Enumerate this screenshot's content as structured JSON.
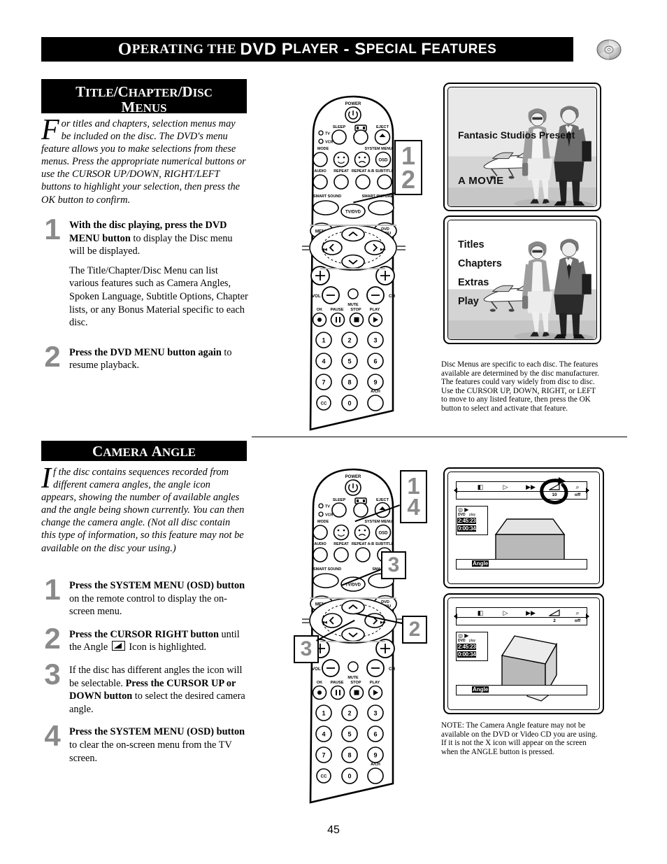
{
  "header": {
    "title_parts": [
      "O",
      "PERATING THE ",
      "DVD",
      "P",
      "LAYER",
      " - ",
      "S",
      "PECIAL ",
      "F",
      "EATURES"
    ],
    "title_full": "OPERATING THE DVD PLAYER - SPECIAL FEATURES",
    "disc_icon": "dvd-disc-icon"
  },
  "section1": {
    "bar_line1": "TITLE/CHAPTER/DISC",
    "bar_line2": "MENUS",
    "intro_dropcap": "F",
    "intro_text": "or titles and chapters, selection menus may be included on the disc. The DVD's menu feature allows you to make selections from these menus. Press the appropriate numerical buttons or use the CURSOR UP/DOWN, RIGHT/LEFT buttons to highlight your selection, then press the OK button to confirm.",
    "steps": [
      {
        "num": "1",
        "bold": "With the disc playing, press the DVD MENU button",
        "rest": " to display the Disc menu will be displayed.",
        "sub": "The Title/Chapter/Disc Menu can list various features such as Camera Angles, Spoken Language, Subtitle Options, Chapter lists, or any Bonus Material specific to each disc."
      },
      {
        "num": "2",
        "bold": "Press the DVD MENU button again",
        "rest": " to resume playback.",
        "sub": ""
      }
    ],
    "caption": "Disc Menus are specific to each disc. The features available are determined by the disc manufacturer. The features could vary widely from disc to disc. Use the CURSOR UP, DOWN, RIGHT, or LEFT to move to any listed feature, then press the OK button to select and activate that feature.",
    "callouts": [
      "1",
      "2"
    ],
    "tv1": {
      "line1": "Fantasic Studios Present",
      "line2": "A MOVIE"
    },
    "tv2": {
      "items": [
        "Titles",
        "Chapters",
        "Extras",
        "Play"
      ]
    }
  },
  "section2": {
    "bar_line1": "CAMERA ANGLE",
    "intro_dropcap": "I",
    "intro_text": "f the disc contains sequences recorded from different camera angles, the angle icon appears, showing the number of available angles and the angle being shown currently. You can then change the camera angle. (Not all disc contain this type of information, so this feature may not be available on the disc your using.)",
    "steps": [
      {
        "num": "1",
        "bold": "Press the SYSTEM MENU (OSD) button",
        "rest": " on the remote control to display the on-screen menu.",
        "sub": ""
      },
      {
        "num": "2",
        "bold": "Press the CURSOR RIGHT button",
        "rest": " until the Angle ▱ Icon is highlighted.",
        "rest_pre": " until the Angle ",
        "rest_post": " Icon is highlighted.",
        "sub": ""
      },
      {
        "num": "3",
        "bold": "",
        "pre": "If the disc has different angles the icon will be selectable. ",
        "boldmid": "Press the CURSOR UP or DOWN button",
        "rest": " to select the desired camera angle.",
        "sub": ""
      },
      {
        "num": "4",
        "bold": "Press the SYSTEM MENU (OSD) button",
        "rest": " to clear the on-screen menu from the TV screen.",
        "sub": ""
      }
    ],
    "caption": "NOTE: The Camera Angle feature may not be available on the DVD or Video CD you are using. If it is not the X icon will appear on the screen when the ANGLE button is pressed.",
    "callouts": [
      "1",
      "4",
      "3",
      "2",
      "3"
    ],
    "osd1": {
      "icons": [
        "subtitle-icon",
        "audio-icon",
        "fast-forward-icon",
        "angle-icon",
        "zoom-icon"
      ],
      "angle_value": "10",
      "zoom_value": "off",
      "disc_type": "DVD",
      "play_label": "play",
      "total_time": "2:45:23",
      "elapsed_time": "0:00:34",
      "label": "Angle",
      "rotate_arrow": "circular-arrow-icon"
    },
    "osd2": {
      "icons": [
        "subtitle-icon",
        "audio-icon",
        "fast-forward-icon",
        "angle-icon",
        "zoom-icon"
      ],
      "angle_value": "2",
      "zoom_value": "off",
      "disc_type": "DVD",
      "play_label": "play",
      "total_time": "2:45:23",
      "elapsed_time": "0:00:34",
      "label": "Angle"
    }
  },
  "remote": {
    "labels": {
      "power": "POWER",
      "sleep": "SLEEP",
      "eject": "EJECT",
      "tv": "TV",
      "vcr": "VCR",
      "mode": "MODE",
      "system_menu": "SYSTEM MENU",
      "osd": "OSD",
      "audio": "AUDIO",
      "repeat": "REPEAT",
      "repeat_ab": "REPEAT A-B",
      "subtitle": "SUBTITLE",
      "smart_sound": "SMART SOUND",
      "smart_picture": "SMART PICTURE",
      "smart_picture_short": "SMART PIC",
      "tvdvd": "TV/DVD",
      "menu": "MENU",
      "dvd_menu_l1": "DVD",
      "dvd_menu_l2": "MENU",
      "vol": "VOL",
      "ch": "CH",
      "mute": "MUTE",
      "ok": "OK",
      "pause": "PAUSE",
      "stop": "STOP",
      "play": "PLAY",
      "cc": "CC",
      "ach": "A/CH"
    },
    "keypad": [
      "1",
      "2",
      "3",
      "4",
      "5",
      "6",
      "7",
      "8",
      "9",
      "CC",
      "0",
      "A/CH"
    ]
  },
  "page_number": "45"
}
